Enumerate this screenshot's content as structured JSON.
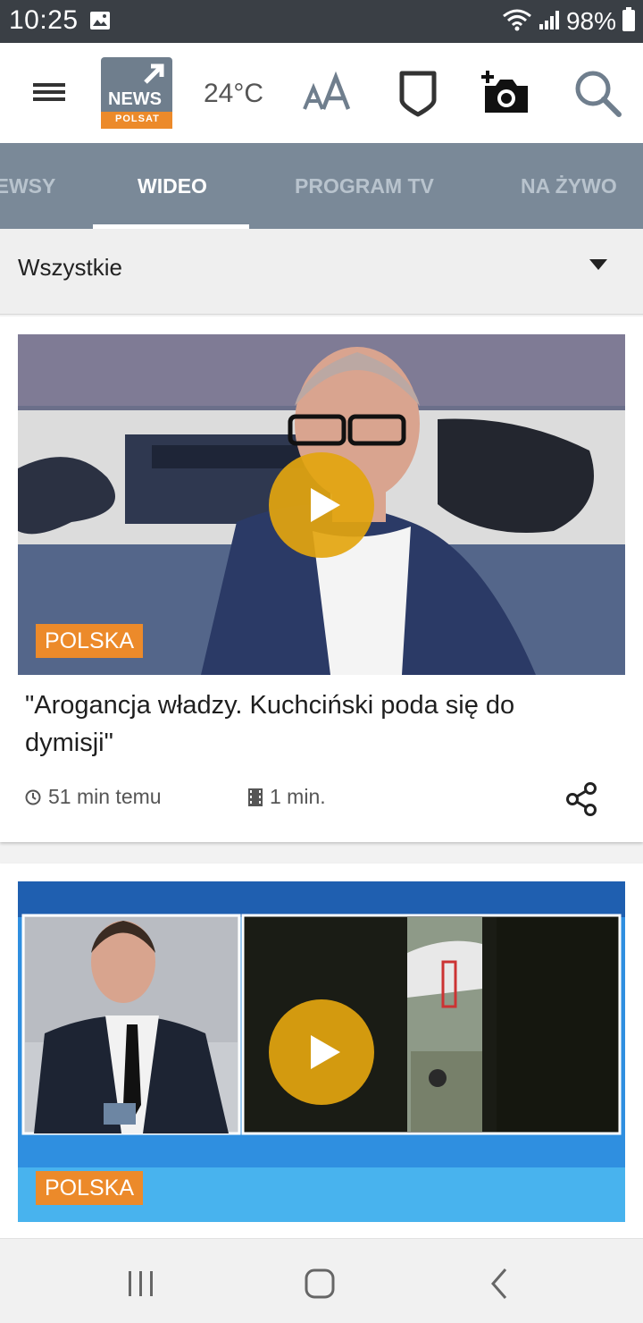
{
  "status_bar": {
    "time": "10:25",
    "battery": "98%"
  },
  "header": {
    "logo_text": "NEWS",
    "logo_subtext": "POLSAT",
    "temperature": "24°C",
    "font_size_label": "AA"
  },
  "tabs": [
    {
      "label": "NEWSY",
      "active": false
    },
    {
      "label": "WIDEO",
      "active": true
    },
    {
      "label": "PROGRAM TV",
      "active": false
    },
    {
      "label": "NA ŻYWO",
      "active": false
    }
  ],
  "filter": {
    "selected": "Wszystkie"
  },
  "cards": [
    {
      "category": "POLSKA",
      "title": "\"Arogancja władzy. Kuchciński poda się do dymisji\"",
      "time_ago": "51 min temu",
      "duration": "1 min."
    },
    {
      "category": "POLSKA"
    }
  ],
  "colors": {
    "tab_bar": "#7a8998",
    "badge": "#ec8a2a",
    "play_button": "#e3a50f",
    "status_bar": "#3a3f45"
  }
}
